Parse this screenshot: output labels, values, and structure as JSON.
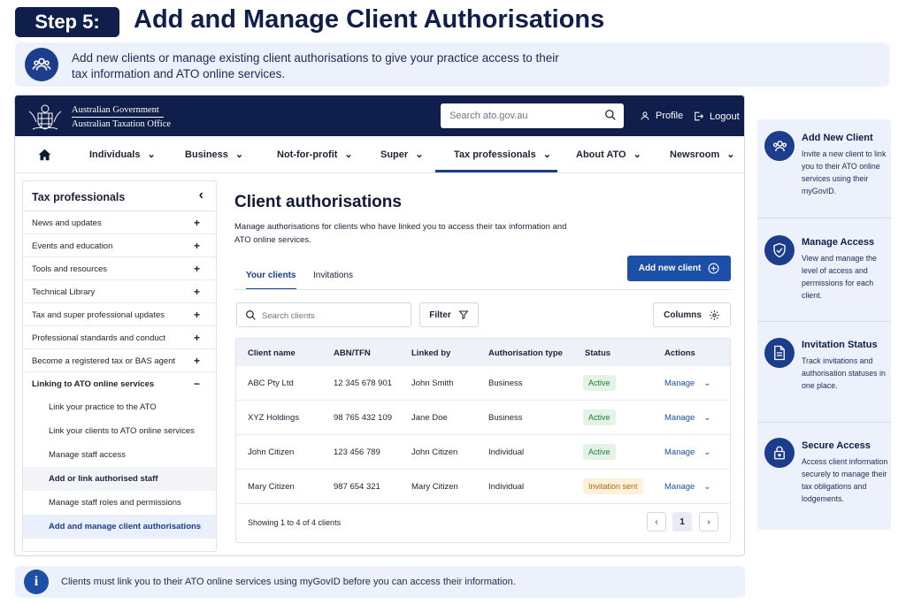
{
  "header": {
    "step_label": "Step 5:",
    "title": "Add and Manage Client Authorisations",
    "intro": "Add new clients or manage existing client authorisations to give your practice access to their tax information and ATO online services."
  },
  "site": {
    "gov_line1": "Australian Government",
    "gov_line2": "Australian Taxation Office",
    "search_placeholder": "Search ato.gov.au",
    "profile_label": "Profile",
    "logout_label": "Logout"
  },
  "nav": {
    "items": [
      "Individuals",
      "Business",
      "Not-for-profit",
      "Super",
      "Tax professionals",
      "About ATO",
      "Newsroom"
    ],
    "active": "Tax professionals"
  },
  "sidebar": {
    "heading": "Tax professionals",
    "items": [
      {
        "label": "News and updates",
        "toggle": "+"
      },
      {
        "label": "Events and education",
        "toggle": "+"
      },
      {
        "label": "Tools and resources",
        "toggle": "+"
      },
      {
        "label": "Technical Library",
        "toggle": "+"
      },
      {
        "label": "Tax and super professional updates",
        "toggle": "+"
      },
      {
        "label": "Professional standards and conduct",
        "toggle": "+"
      },
      {
        "label": "Become a registered tax or BAS agent",
        "toggle": "+"
      },
      {
        "label": "Linking to ATO online services",
        "toggle": "−"
      }
    ],
    "subitems": [
      "Link your practice to the ATO",
      "Link your clients to ATO online services",
      "Manage staff access",
      "Add or link authorised staff",
      "Manage staff roles and permissions",
      "Add and manage client authorisations"
    ]
  },
  "content": {
    "title": "Client authorisations",
    "description": "Manage authorisations for clients who have linked you to access their tax information and ATO online services.",
    "tabs": [
      "Your clients",
      "Invitations"
    ],
    "add_button": "Add new client",
    "search_placeholder": "Search clients",
    "filter_label": "Filter",
    "columns_label": "Columns",
    "table": {
      "headers": [
        "Client name",
        "ABN/TFN",
        "Linked by",
        "Authorisation type",
        "Status",
        "Actions"
      ],
      "rows": [
        {
          "name": "ABC Pty Ltd",
          "id": "12 345 678 901",
          "linked_by": "John Smith",
          "type": "Business",
          "status": "Active",
          "action": "Manage"
        },
        {
          "name": "XYZ Holdings",
          "id": "98 765 432 109",
          "linked_by": "Jane Doe",
          "type": "Business",
          "status": "Active",
          "action": "Manage"
        },
        {
          "name": "John Citizen",
          "id": "123 456 789",
          "linked_by": "John Citizen",
          "type": "Individual",
          "status": "Active",
          "action": "Manage"
        },
        {
          "name": "Mary Citizen",
          "id": "987 654 321",
          "linked_by": "Mary Citizen",
          "type": "Individual",
          "status": "Invitation sent",
          "action": "Manage"
        }
      ]
    },
    "showing": "Showing 1 to 4 of 4 clients",
    "page": "1"
  },
  "panel": {
    "cards": [
      {
        "title": "Add New Client",
        "desc": "Invite a new client to link you to their ATO online services using their myGovID.",
        "icon": "users-icon"
      },
      {
        "title": "Manage Access",
        "desc": "View and manage the level of access and permissions for each client.",
        "icon": "shield-check-icon"
      },
      {
        "title": "Invitation Status",
        "desc": "Track invitations and authorisation statuses in one place.",
        "icon": "document-icon"
      },
      {
        "title": "Secure Access",
        "desc": "Access client information securely to manage their tax obligations and lodgements.",
        "icon": "lock-icon"
      }
    ]
  },
  "note": {
    "text": "Clients must link you to their ATO online services using myGovID before you can access their information."
  },
  "colors": {
    "navy": "#0f1e4a",
    "accent_blue": "#1c4fa8",
    "panel_bg": "#edf1fb",
    "active_green": "#1e7a36",
    "pending_orange": "#b06a0d"
  }
}
